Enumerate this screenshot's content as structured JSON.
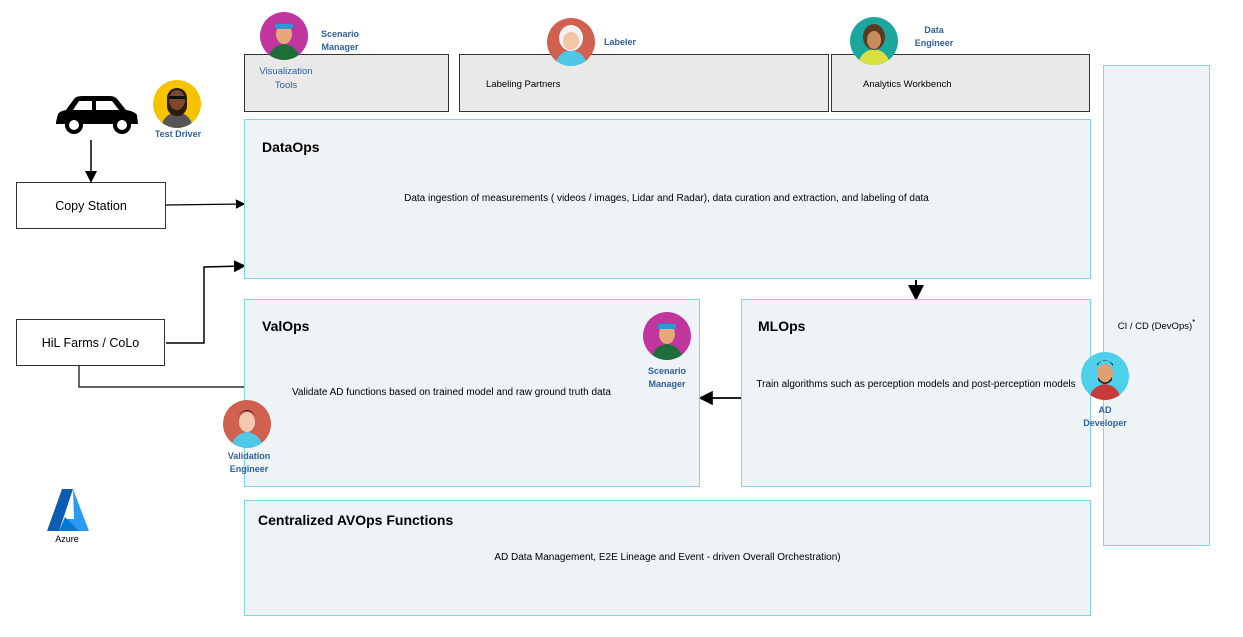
{
  "tools": {
    "visualization": "Visualization Tools",
    "labeling": "Labeling Partners",
    "analytics": "Analytics Workbench"
  },
  "roles": {
    "scenario_manager": "Scenario Manager",
    "labeler": "Labeler",
    "data_engineer": "Data Engineer",
    "test_driver": "Test Driver",
    "ad_developer": "AD Developer",
    "validation_engineer": "Validation Engineer"
  },
  "sources": {
    "copy_station": "Copy Station",
    "hil_farms": "HiL Farms / CoLo"
  },
  "dataops": {
    "title": "DataOps",
    "description": "Data ingestion of measurements ( videos / images, Lidar and Radar), data curation and extraction, and labeling of data"
  },
  "valops": {
    "title": "ValOps",
    "description": "Validate AD functions based on trained model and raw ground truth data"
  },
  "mlops": {
    "title": "MLOps",
    "description": "Train algorithms such as perception models and post-perception models"
  },
  "central": {
    "title": "Centralized AVOps Functions",
    "description": "AD Data Management, E2E Lineage and Event - driven Overall Orchestration)"
  },
  "cicd": {
    "label": "CI / CD (DevOps)",
    "mark": "*"
  },
  "azure": {
    "label": "Azure"
  },
  "colors": {
    "role_text": "#2f5f9e",
    "panel_fill": "#eef3f5",
    "panel_border": "#7fd6e8",
    "tool_fill": "#e9e9e9",
    "azure_blue": "#0078d4"
  }
}
